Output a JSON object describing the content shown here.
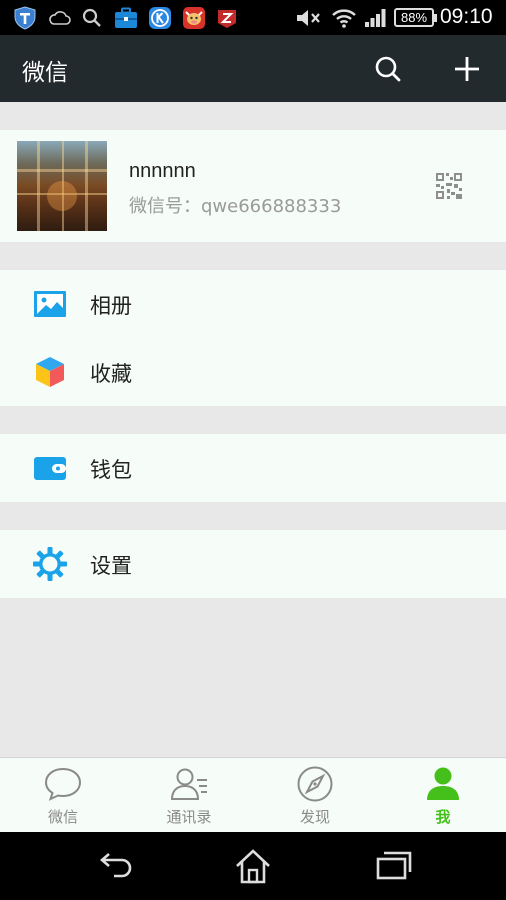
{
  "status_bar": {
    "battery": "88%",
    "time": "09:10",
    "icons": [
      "shield-app-icon",
      "cloud-icon",
      "search-notify-icon",
      "toolbox-app-icon",
      "kugou-app-icon",
      "cow-app-icon",
      "z-app-icon",
      "mute-icon",
      "wifi-icon",
      "signal-icon"
    ]
  },
  "header": {
    "title": "微信",
    "actions": [
      "search-icon",
      "plus-icon"
    ]
  },
  "profile": {
    "nickname": "nnnnnn",
    "wechat_id": "微信号：qwe666888333"
  },
  "menu": {
    "items": [
      {
        "label": "相册",
        "icon": "album-icon"
      },
      {
        "label": "收藏",
        "icon": "favorites-icon"
      },
      {
        "label": "钱包",
        "icon": "wallet-icon"
      },
      {
        "label": "设置",
        "icon": "settings-icon"
      }
    ]
  },
  "tabs": [
    {
      "label": "微信",
      "icon": "chat-icon",
      "active": false
    },
    {
      "label": "通讯录",
      "icon": "contacts-icon",
      "active": false
    },
    {
      "label": "发现",
      "icon": "discover-icon",
      "active": false
    },
    {
      "label": "我",
      "icon": "me-icon",
      "active": true
    }
  ],
  "colors": {
    "header_bg": "#232a2d",
    "accent": "#45c01a",
    "icon_blue": "#1aa3e8",
    "card_bg": "#f6fcf7",
    "page_bg": "#e8e8e8"
  },
  "nav": [
    "back-icon",
    "home-icon",
    "recents-icon"
  ]
}
